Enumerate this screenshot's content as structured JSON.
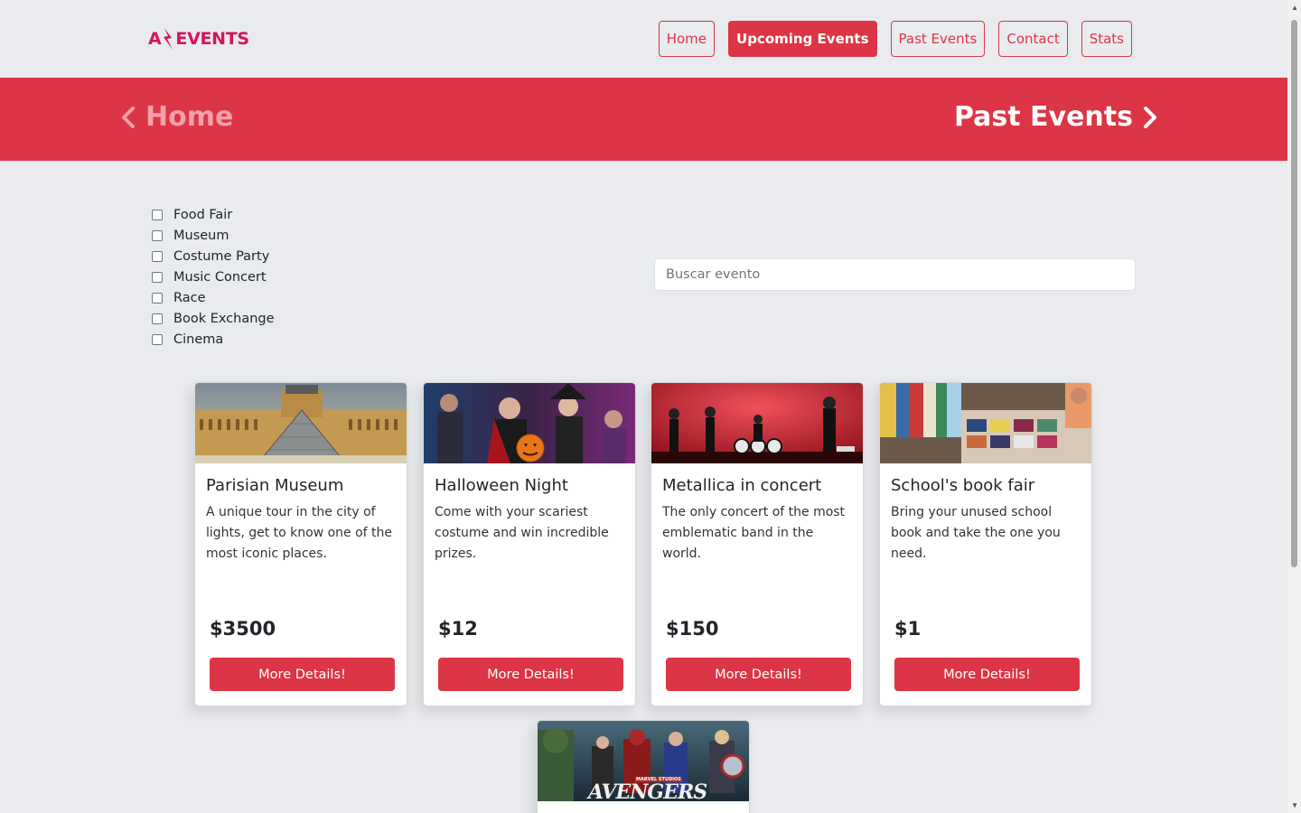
{
  "brand": {
    "logo_left": "A",
    "logo_right": "EVENTS"
  },
  "nav": [
    {
      "label": "Home",
      "active": false
    },
    {
      "label": "Upcoming Events",
      "active": true
    },
    {
      "label": "Past Events",
      "active": false
    },
    {
      "label": "Contact",
      "active": false
    },
    {
      "label": "Stats",
      "active": false
    }
  ],
  "banner": {
    "prev": "Home",
    "next": "Past Events"
  },
  "filters": [
    "Food Fair",
    "Museum",
    "Costume Party",
    "Music Concert",
    "Race",
    "Book Exchange",
    "Cinema"
  ],
  "search": {
    "placeholder": "Buscar evento",
    "value": ""
  },
  "cards": [
    {
      "title": "Parisian Museum",
      "description": "A unique tour in the city of lights, get to know one of the most iconic places.",
      "price": "$3500",
      "button": "More Details!"
    },
    {
      "title": "Halloween Night",
      "description": "Come with your scariest costume and win incredible prizes.",
      "price": "$12",
      "button": "More Details!"
    },
    {
      "title": "Metallica in concert",
      "description": "The only concert of the most emblematic band in the world.",
      "price": "$150",
      "button": "More Details!"
    },
    {
      "title": "School's book fair",
      "description": "Bring your unused school book and take the one you need.",
      "price": "$1",
      "button": "More Details!"
    }
  ],
  "partial_card": {
    "image_text": "AVENGERS",
    "image_subtext": "MARVEL STUDIOS"
  },
  "colors": {
    "accent": "#dc3545",
    "brand": "#d7145a",
    "background": "#e9ebee"
  }
}
